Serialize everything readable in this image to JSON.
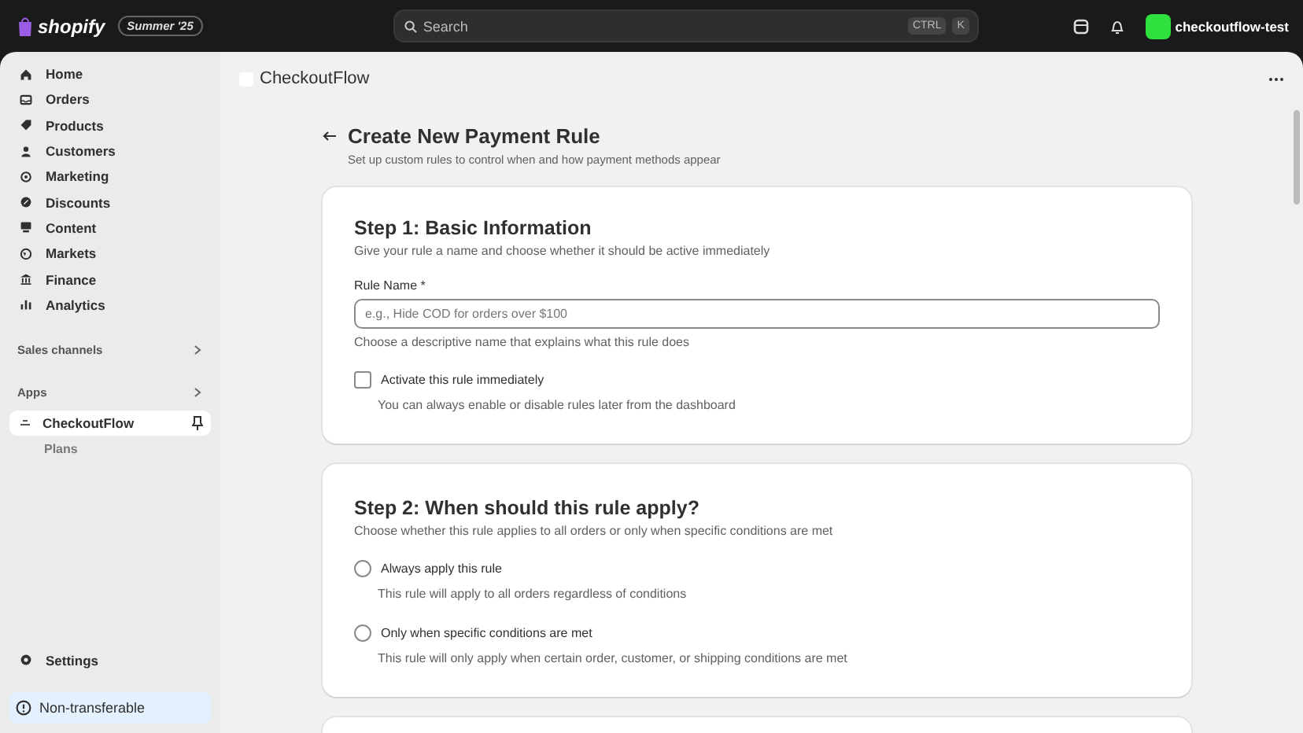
{
  "topbar": {
    "logo_text": "shopify",
    "edition_badge": "Summer '25",
    "search": {
      "placeholder": "Search",
      "shortcut_keys": [
        "CTRL",
        "K"
      ]
    },
    "store_name": "checkoutflow-test"
  },
  "sidebar": {
    "items": [
      {
        "label": "Home"
      },
      {
        "label": "Orders"
      },
      {
        "label": "Products"
      },
      {
        "label": "Customers"
      },
      {
        "label": "Marketing"
      },
      {
        "label": "Discounts"
      },
      {
        "label": "Content"
      },
      {
        "label": "Markets"
      },
      {
        "label": "Finance"
      },
      {
        "label": "Analytics"
      }
    ],
    "sections": [
      {
        "label": "Sales channels"
      },
      {
        "label": "Apps"
      }
    ],
    "app": {
      "label": "CheckoutFlow",
      "selected": true,
      "children": [
        {
          "label": "Plans",
          "selected": false
        }
      ]
    },
    "settings": "Settings",
    "notice": "Non-transferable"
  },
  "app_header": {
    "title": "CheckoutFlow"
  },
  "page": {
    "title": "Create New Payment Rule",
    "subtitle": "Set up custom rules to control when and how payment methods appear"
  },
  "steps": [
    {
      "title": "Step 1: Basic Information",
      "description": "Give your rule a name and choose whether it should be active immediately",
      "field": {
        "label": "Rule Name *",
        "placeholder": "e.g., Hide COD for orders over $100",
        "help": "Choose a descriptive name that explains what this rule does"
      },
      "options": [
        {
          "kind": "checkbox",
          "label": "Activate this rule immediately",
          "hint": "You can always enable or disable rules later from the dashboard",
          "checked": false
        }
      ]
    },
    {
      "title": "Step 2: When should this rule apply?",
      "description": "Choose whether this rule applies to all orders or only when specific conditions are met",
      "options": [
        {
          "kind": "radio",
          "label": "Always apply this rule",
          "hint": "This rule will apply to all orders regardless of conditions",
          "selected": false
        },
        {
          "kind": "radio",
          "label": "Only when specific conditions are met",
          "hint": "This rule will only apply when certain order, customer, or shipping conditions are met",
          "selected": false
        }
      ]
    }
  ]
}
